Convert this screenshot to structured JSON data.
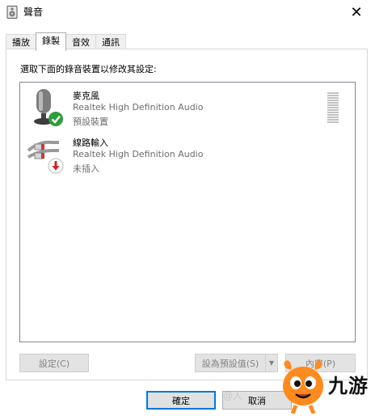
{
  "window": {
    "title": "聲音",
    "close_label": "✕"
  },
  "tabs": [
    {
      "label": "播放",
      "active": false
    },
    {
      "label": "錄製",
      "active": true
    },
    {
      "label": "音效",
      "active": false
    },
    {
      "label": "通訊",
      "active": false
    }
  ],
  "panel": {
    "instruction": "選取下面的錄音裝置以修改其設定:",
    "devices": [
      {
        "name": "麥克風",
        "driver": "Realtek High Definition Audio",
        "status": "預設裝置",
        "icon": "microphone-icon",
        "badge": "check-badge-icon"
      },
      {
        "name": "線路輸入",
        "driver": "Realtek High Definition Audio",
        "status": "未插入",
        "icon": "line-in-cable-icon",
        "badge": "unplugged-badge-icon"
      }
    ],
    "configure_label": "設定(C)",
    "set_default_label": "設為預設值(S)",
    "properties_label": "內容(P)"
  },
  "footer": {
    "ok_label": "確定",
    "cancel_label": "取消"
  },
  "watermark": {
    "text": "九游",
    "ghost_text": "@人"
  },
  "colors": {
    "accent": "#0078d7",
    "check_green": "#2e9d3a",
    "unplug_red": "#d21f1f"
  }
}
